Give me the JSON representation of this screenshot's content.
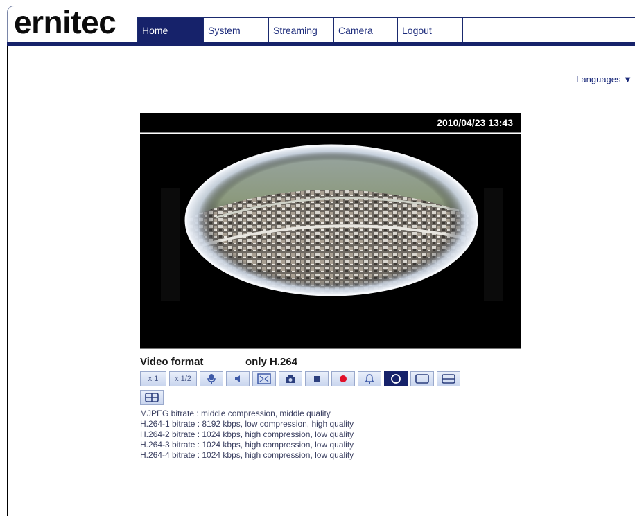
{
  "brand": {
    "logo": "ernitec"
  },
  "nav": {
    "items": [
      {
        "label": "Home",
        "active": true
      },
      {
        "label": "System",
        "active": false
      },
      {
        "label": "Streaming",
        "active": false
      },
      {
        "label": "Camera",
        "active": false
      },
      {
        "label": "Logout",
        "active": false
      }
    ]
  },
  "languages": {
    "label": "Languages ▼"
  },
  "video": {
    "timestamp": "2010/04/23 13:43",
    "format_label": "Video format",
    "format_value": "only H.264"
  },
  "controls": {
    "zoom_x1": "x 1",
    "zoom_half": "x 1/2",
    "buttons": [
      "mic-icon",
      "speaker-icon",
      "fullscreen-icon",
      "snapshot-icon",
      "stop-icon",
      "record-icon",
      "alarm-icon",
      "fisheye-view-icon",
      "single-view-icon",
      "dual-view-icon",
      "quad-view-icon"
    ]
  },
  "bitrates": [
    "MJPEG bitrate : middle compression, middle quality",
    "H.264-1 bitrate : 8192 kbps, low compression, high quality",
    "H.264-2 bitrate : 1024 kbps, high compression, low quality",
    "H.264-3 bitrate : 1024 kbps, high compression, low quality",
    "H.264-4 bitrate : 1024 kbps, high compression, low quality"
  ],
  "colors": {
    "brand_navy": "#16226a",
    "nav_text": "#1b2a7a",
    "record_red": "#e0102a"
  }
}
